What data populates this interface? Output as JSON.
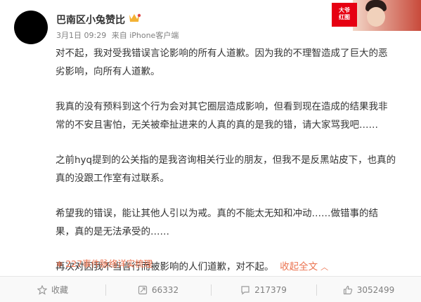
{
  "post": {
    "username": "巴南区小兔赞比",
    "timestamp": "3月1日 09:29",
    "source": "来自 iPhone客户端",
    "badge_text": "大爷\n红图"
  },
  "content": {
    "paragraphs": [
      "对不起，我对受我错误言论影响的所有人道歉。因为我的不理智造成了巨大的恶\n劣影响，向所有人道歉。",
      "我真的没有预料到这个行为会对其它圈层造成影响，但看到现在造成的结果我非\n常的不安且害怕，无关被牵扯进来的人真的真的是我的错，请大家骂我吧……",
      "之前hyq提到的公关指的是我咨询相关行业的朋友，但我不是反黑站皮下，也真的\n真的没跟工作室有过联系。",
      "希望我的错误，能让其他人引以为戒。真的不能太无知和冲动……做错事的结\n果，真的是无法承受的……",
      "再次对因我不当言行而被影响的人们道歉，对不起。"
    ],
    "collapse_label": "收起全文",
    "events_label": "227事件脉络详实梳理"
  },
  "actions": {
    "favorite_label": "收藏",
    "repost_count": "66332",
    "comment_count": "217379",
    "like_count": "3052499"
  },
  "colors": {
    "accent": "#eb7350",
    "text": "#333333",
    "muted": "#808080"
  },
  "icons": {
    "favorite": "star-icon",
    "repost": "repost-icon",
    "comment": "comment-icon",
    "like": "thumbs-up-icon",
    "vip": "vip-badge-icon",
    "collapse": "chevron-up-icon"
  }
}
